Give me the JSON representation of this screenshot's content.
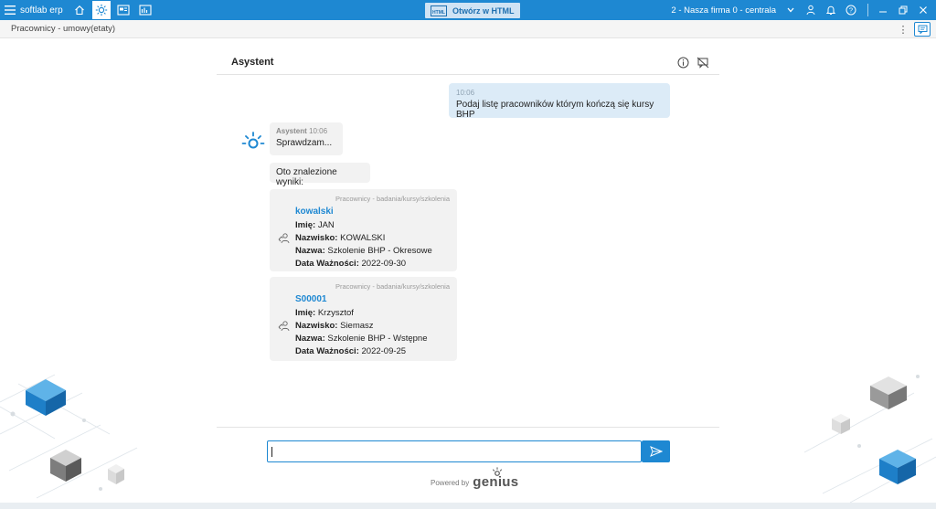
{
  "topbar": {
    "app_title": "softlab erp",
    "open_html_label": "Otwórz w HTML",
    "open_html_icon_text": "HTML",
    "company": "2 - Nasza firma 0 - centrala",
    "icons": [
      "menu-icon",
      "home-icon",
      "sun-icon",
      "screen-icon",
      "chart-icon",
      "user-icon",
      "bell-icon",
      "help-icon",
      "minimize-icon",
      "restore-icon",
      "close-icon"
    ],
    "accent_color": "#1e88d2"
  },
  "subbar": {
    "breadcrumb": "Pracownicy - umowy(etaty)"
  },
  "assistant": {
    "title": "Asystent",
    "user_message": {
      "time": "10:06",
      "text": "Podaj listę pracowników którym kończą się kursy BHP"
    },
    "bot_message": {
      "author": "Asystent",
      "time": "10:06",
      "text": "Sprawdzam..."
    },
    "results_intro": "Oto znalezione wyniki:",
    "results": [
      {
        "category": "Pracownicy - badania/kursy/szkolenia",
        "link": "kowalski",
        "fields": [
          {
            "label": "Imię:",
            "value": "JAN"
          },
          {
            "label": "Nazwisko:",
            "value": "KOWALSKI"
          },
          {
            "label": "Nazwa:",
            "value": "Szkolenie BHP - Okresowe"
          },
          {
            "label": "Data Ważności:",
            "value": "2022-09-30"
          }
        ]
      },
      {
        "category": "Pracownicy - badania/kursy/szkolenia",
        "link": "S00001",
        "fields": [
          {
            "label": "Imię:",
            "value": "Krzysztof"
          },
          {
            "label": "Nazwisko:",
            "value": "Siemasz"
          },
          {
            "label": "Nazwa:",
            "value": "Szkolenie BHP - Wstępne"
          },
          {
            "label": "Data Ważności:",
            "value": "2022-09-25"
          }
        ]
      }
    ],
    "input": {
      "value": "",
      "placeholder": ""
    },
    "powered_by": "Powered by",
    "brand": "genius"
  }
}
